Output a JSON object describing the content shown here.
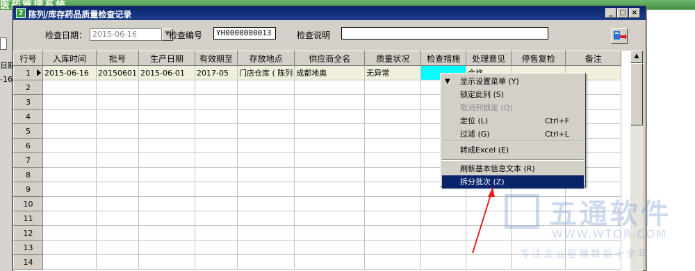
{
  "background_app": {
    "title": "医药管理系统",
    "left_header_fragment": "日期",
    "left_cell_fragment": "-16"
  },
  "window": {
    "title": "陈列/库存药品质量检查记录",
    "controls": {
      "minimize": "_",
      "maximize": "□",
      "close": "×"
    }
  },
  "toolbar": {
    "date_label": "检查日期：",
    "date_value": "2015-06-16",
    "code_label": "检查编号",
    "code_value": "YH0000000013",
    "desc_label": "检查说明",
    "desc_value": ""
  },
  "grid": {
    "columns": [
      "行号",
      "入库时间",
      "批号",
      "生产日期",
      "有效期至",
      "存放地点",
      "供应商全名",
      "质量状况",
      "检查措施",
      "处理意见",
      "停售复检",
      "备注"
    ],
    "rows": [
      {
        "no": "1",
        "cells": [
          "2015-06-16",
          "20150601",
          "2015-06-01",
          "2017-05",
          "门店仓库 ( 陈列",
          "成都地奥",
          "无异常",
          "",
          "合格",
          "",
          ""
        ]
      },
      {
        "no": "2",
        "cells": []
      },
      {
        "no": "3",
        "cells": []
      },
      {
        "no": "4",
        "cells": []
      },
      {
        "no": "5",
        "cells": []
      },
      {
        "no": "6",
        "cells": []
      },
      {
        "no": "7",
        "cells": []
      },
      {
        "no": "8",
        "cells": []
      },
      {
        "no": "9",
        "cells": []
      },
      {
        "no": "10",
        "cells": []
      },
      {
        "no": "11",
        "cells": []
      },
      {
        "no": "12",
        "cells": []
      },
      {
        "no": "13",
        "cells": []
      },
      {
        "no": "14",
        "cells": []
      }
    ]
  },
  "context_menu": {
    "items": [
      {
        "label": "显示设置菜单 (Y)",
        "shortcut": "",
        "state": "normal",
        "submenu_glyph": "▼"
      },
      {
        "label": "锁定此列 (S)",
        "shortcut": "",
        "state": "normal"
      },
      {
        "label": "取消列锁定 (Q)",
        "shortcut": "",
        "state": "disabled"
      },
      {
        "label": "定位 (L)",
        "shortcut": "Ctrl+F",
        "state": "normal"
      },
      {
        "label": "过滤 (G)",
        "shortcut": "Ctrl+L",
        "state": "normal"
      },
      {
        "label": "转成Excel (E)",
        "shortcut": "",
        "state": "normal"
      },
      {
        "label": "刷新基本信息文本 (R)",
        "shortcut": "",
        "state": "normal"
      },
      {
        "label": "拆分批次 (Z)",
        "shortcut": "",
        "state": "highlighted"
      }
    ]
  },
  "watermark": {
    "brand": "五通软件",
    "url": "WWW.WTOR.COM",
    "slogan": "专注企业管理数据十余年"
  },
  "colors": {
    "title_bar": "#0a246a",
    "selected_cell": "#00ffff",
    "row_highlight": "#f0f0dc",
    "menu_highlight": "#0a246a",
    "annotation_arrow": "#e0201e"
  }
}
